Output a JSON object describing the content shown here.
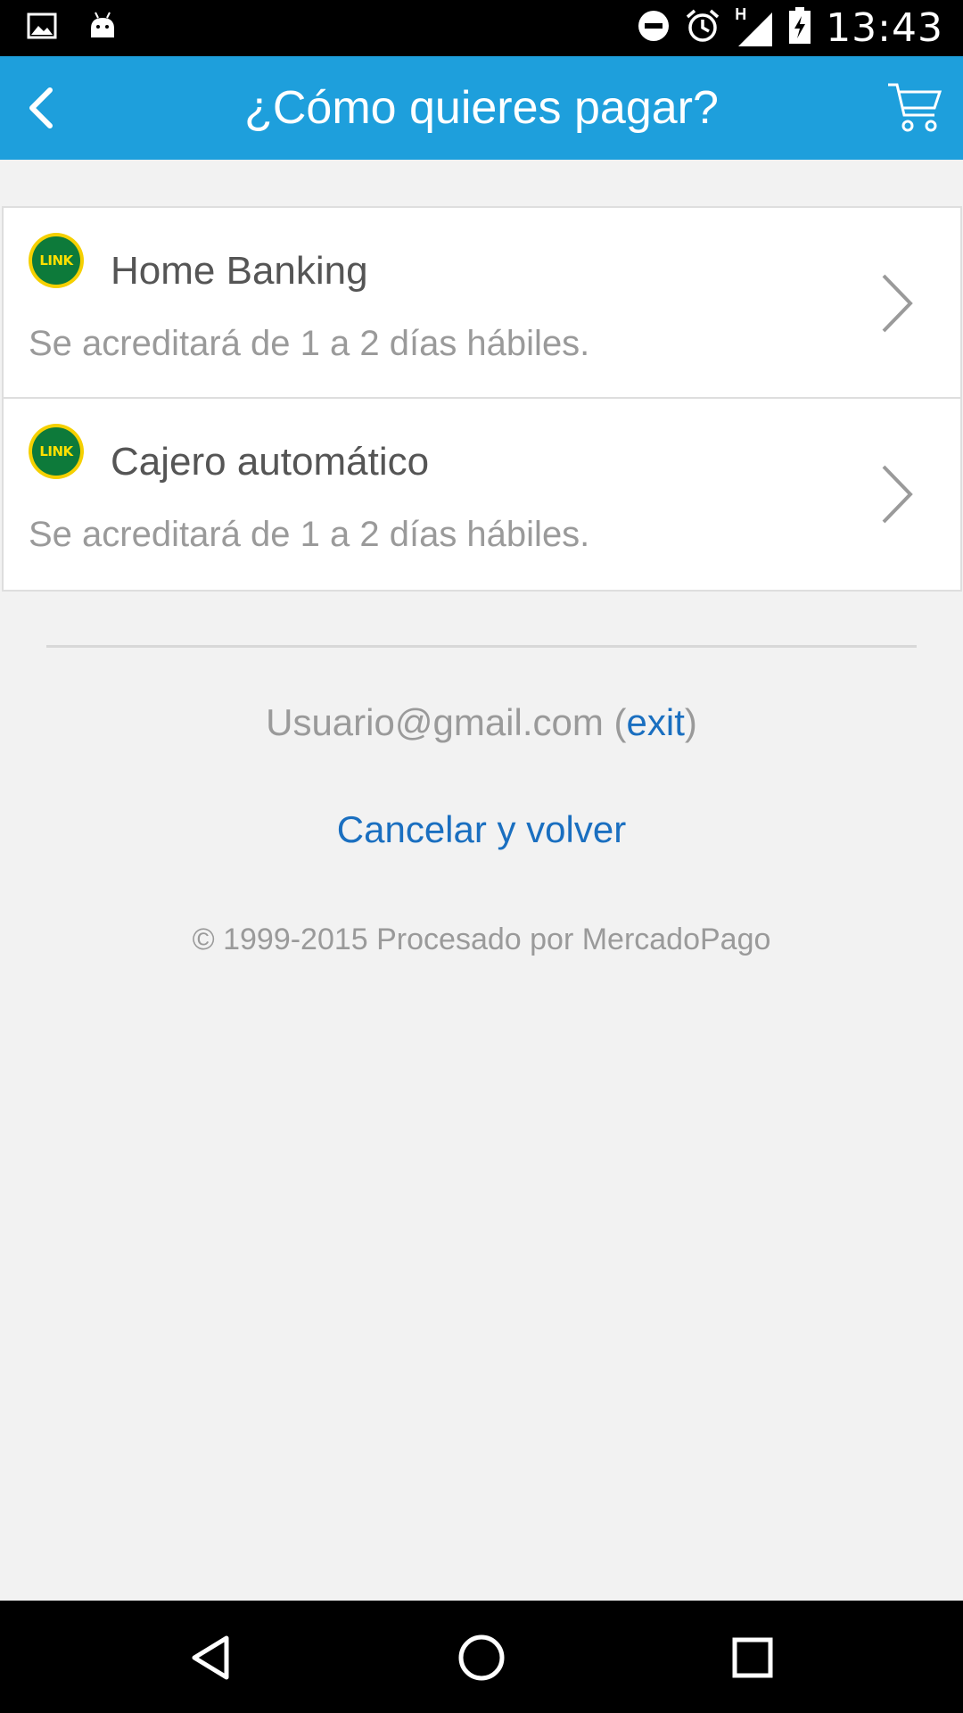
{
  "status_bar": {
    "time": "13:43",
    "network_label": "H"
  },
  "app_bar": {
    "title": "¿Cómo quieres pagar?"
  },
  "payment_methods": [
    {
      "logo_text": "LINK",
      "title": "Home Banking",
      "subtitle": "Se acreditará de 1 a 2 días hábiles."
    },
    {
      "logo_text": "LINK",
      "title": "Cajero automático",
      "subtitle": "Se acreditará de 1 a 2 días hábiles."
    }
  ],
  "footer": {
    "user_email": "Usuario@gmail.com",
    "paren_open": " (",
    "exit_label": "exit",
    "paren_close": ")",
    "cancel_label": "Cancelar y volver",
    "copyright": "© 1999-2015 Procesado por MercadoPago"
  },
  "colors": {
    "app_bar": "#1e9fdc",
    "link": "#1a6fc0",
    "background": "#f2f2f2"
  }
}
